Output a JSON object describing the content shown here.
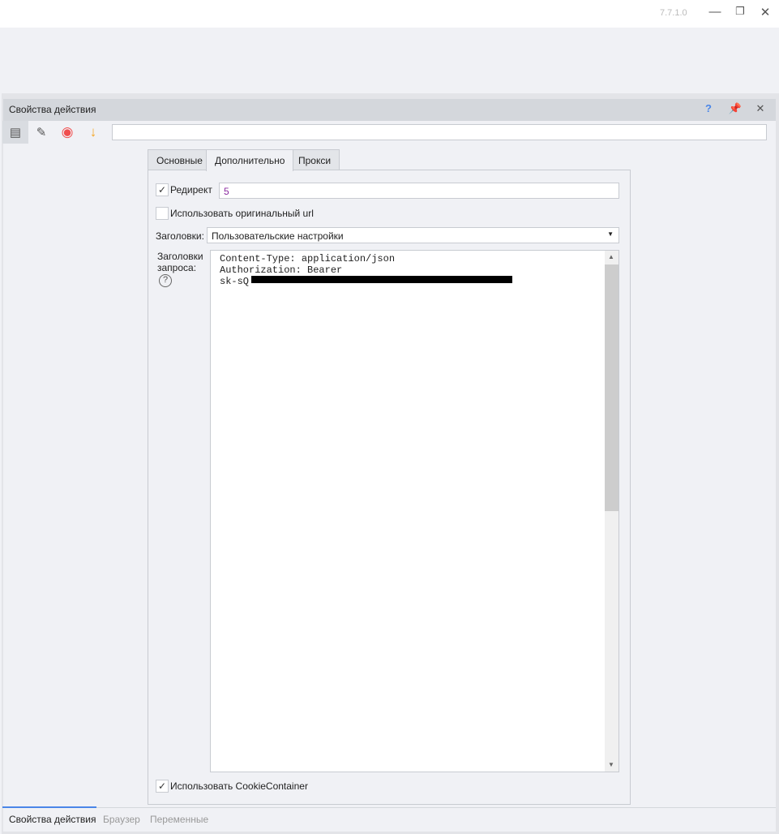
{
  "window": {
    "version": "7.7.1.0",
    "minimize_icon": "minimize-icon",
    "restore_icon": "restore-icon",
    "close_icon": "close-icon"
  },
  "panel": {
    "title": "Свойства действия",
    "help": "?",
    "pin": "pin-icon",
    "close": "close-icon"
  },
  "toolbar": {
    "icons": [
      "properties-gear-icon",
      "edit-icon",
      "record-icon",
      "arrow-down-icon"
    ],
    "input_value": ""
  },
  "tabs": [
    {
      "label": "Основные"
    },
    {
      "label": "Дополнительно",
      "active": true
    },
    {
      "label": "Прокси"
    }
  ],
  "form": {
    "redirect": {
      "label": "Редирект",
      "checked": true,
      "value": "5"
    },
    "original_url": {
      "label": "Использовать оригинальный url",
      "checked": false
    },
    "headers": {
      "label": "Заголовки:",
      "value": "Пользовательские настройки"
    },
    "request_headers": {
      "label_line1": "Заголовки",
      "label_line2": "запроса:",
      "help": "?",
      "lines": [
        "Content-Type: application/json",
        "Authorization: Bearer",
        "sk-sQ"
      ]
    },
    "cookie": {
      "label": "Использовать CookieContainer",
      "checked": true
    }
  },
  "bottom_tabs": [
    {
      "label": "Свойства действия",
      "active": true
    },
    {
      "label": "Браузер"
    },
    {
      "label": "Переменные"
    }
  ],
  "colors": {
    "accent": "#4a86e8",
    "record": "#f04e4e",
    "arrow": "#f5a623"
  }
}
